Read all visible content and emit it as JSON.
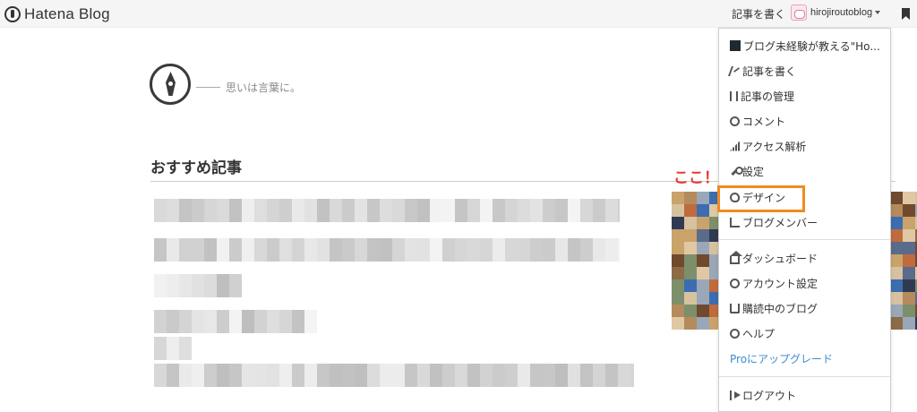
{
  "topbar": {
    "logo_text": "Hatena Blog",
    "write_link": "記事を書く",
    "username": "hirojiroutoblog"
  },
  "blog": {
    "tagline": "思いは言葉に。",
    "section_title": "おすすめ記事"
  },
  "annotation": "ここ！",
  "menu": {
    "blog_name": "ブログ未経験が教える\"Ho...",
    "items": [
      {
        "label": "記事を書く",
        "icon": "pen-icon"
      },
      {
        "label": "記事の管理",
        "icon": "manage-icon"
      },
      {
        "label": "コメント",
        "icon": "comment-icon"
      },
      {
        "label": "アクセス解析",
        "icon": "bars-icon"
      },
      {
        "label": "設定",
        "icon": "wrench-icon"
      },
      {
        "label": "デザイン",
        "icon": "palette-icon"
      },
      {
        "label": "ブログメンバー",
        "icon": "members-icon"
      }
    ],
    "items2": [
      {
        "label": "ダッシュボード",
        "icon": "house-icon"
      },
      {
        "label": "アカウント設定",
        "icon": "account-icon"
      },
      {
        "label": "購読中のブログ",
        "icon": "book-icon"
      },
      {
        "label": "ヘルプ",
        "icon": "help-icon"
      }
    ],
    "pro_upgrade": "Proにアップグレード",
    "logout": "ログアウト"
  },
  "colors": {
    "annotation": "#e53b2c",
    "highlight": "#f28a1f",
    "pro_link": "#3d8bcf"
  }
}
